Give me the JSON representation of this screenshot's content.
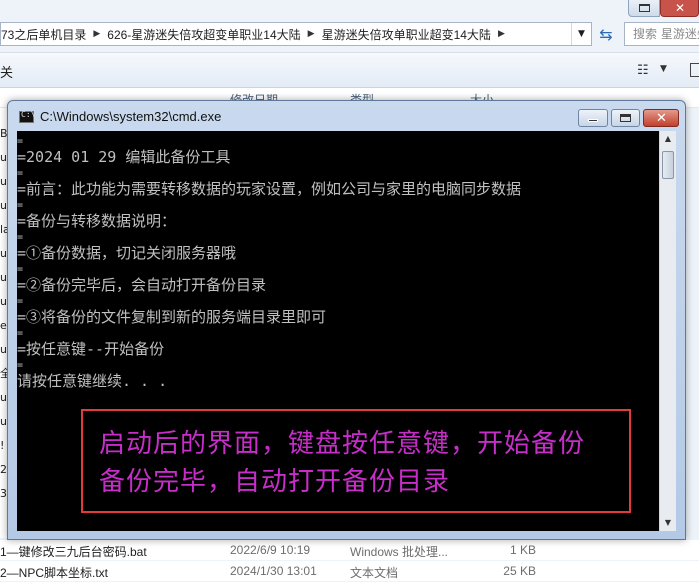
{
  "explorer": {
    "breadcrumbs": [
      "73之后单机目录",
      "626-星游迷失倍攻超变单职业14大陆",
      "星游迷失倍攻单职业超变14大陆"
    ],
    "search_placeholder": "搜索 星游迷失",
    "toolbar_fragment": "关",
    "columns": [
      "修改日期",
      "类型",
      "大小"
    ],
    "left_strip_fragments": [
      "B",
      "ui",
      "ul",
      "ui",
      "la",
      "ur",
      "us",
      "ui",
      "el",
      "us",
      "全",
      "ur",
      "ur",
      "!",
      "2",
      "3"
    ],
    "files": [
      {
        "name": "1—键修改三九后台密码.bat",
        "date": "2022/6/9 10:19",
        "type": "Windows 批处理...",
        "size": "1 KB"
      },
      {
        "name": "2—NPC脚本坐标.txt",
        "date": "2024/1/30 13:01",
        "type": "文本文档",
        "size": "25 KB"
      }
    ]
  },
  "cmd": {
    "title": "C:\\Windows\\system32\\cmd.exe",
    "icon_text": "C:\\",
    "lines": [
      "=2024 01 29 编辑此备份工具",
      "=前言：此功能为需要转移数据的玩家设置，例如公司与家里的电脑同步数据",
      "=备份与转移数据说明：",
      "=①备份数据，切记关闭服务器哦",
      "=②备份完毕后，会自动打开备份目录",
      "=③将备份的文件复制到新的服务端目录里即可",
      "=按任意键--开始备份",
      "请按任意键继续. . ."
    ],
    "separator": "="
  },
  "annotation": {
    "line1": "启动后的界面，键盘按任意键，开始备份",
    "line2": "备份完毕，自动打开备份目录",
    "text_color": "#c72ec9",
    "border_color": "#e23b3b"
  }
}
